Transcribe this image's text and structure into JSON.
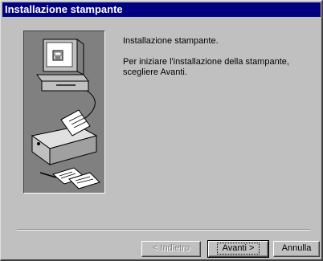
{
  "window": {
    "title": "Installazione stampante"
  },
  "content": {
    "heading": "Installazione stampante.",
    "instruction": "Per iniziare l'installazione della stampante, scegliere Avanti."
  },
  "buttons": {
    "back": "< Indietro",
    "next": "Avanti >",
    "cancel": "Annulla"
  }
}
